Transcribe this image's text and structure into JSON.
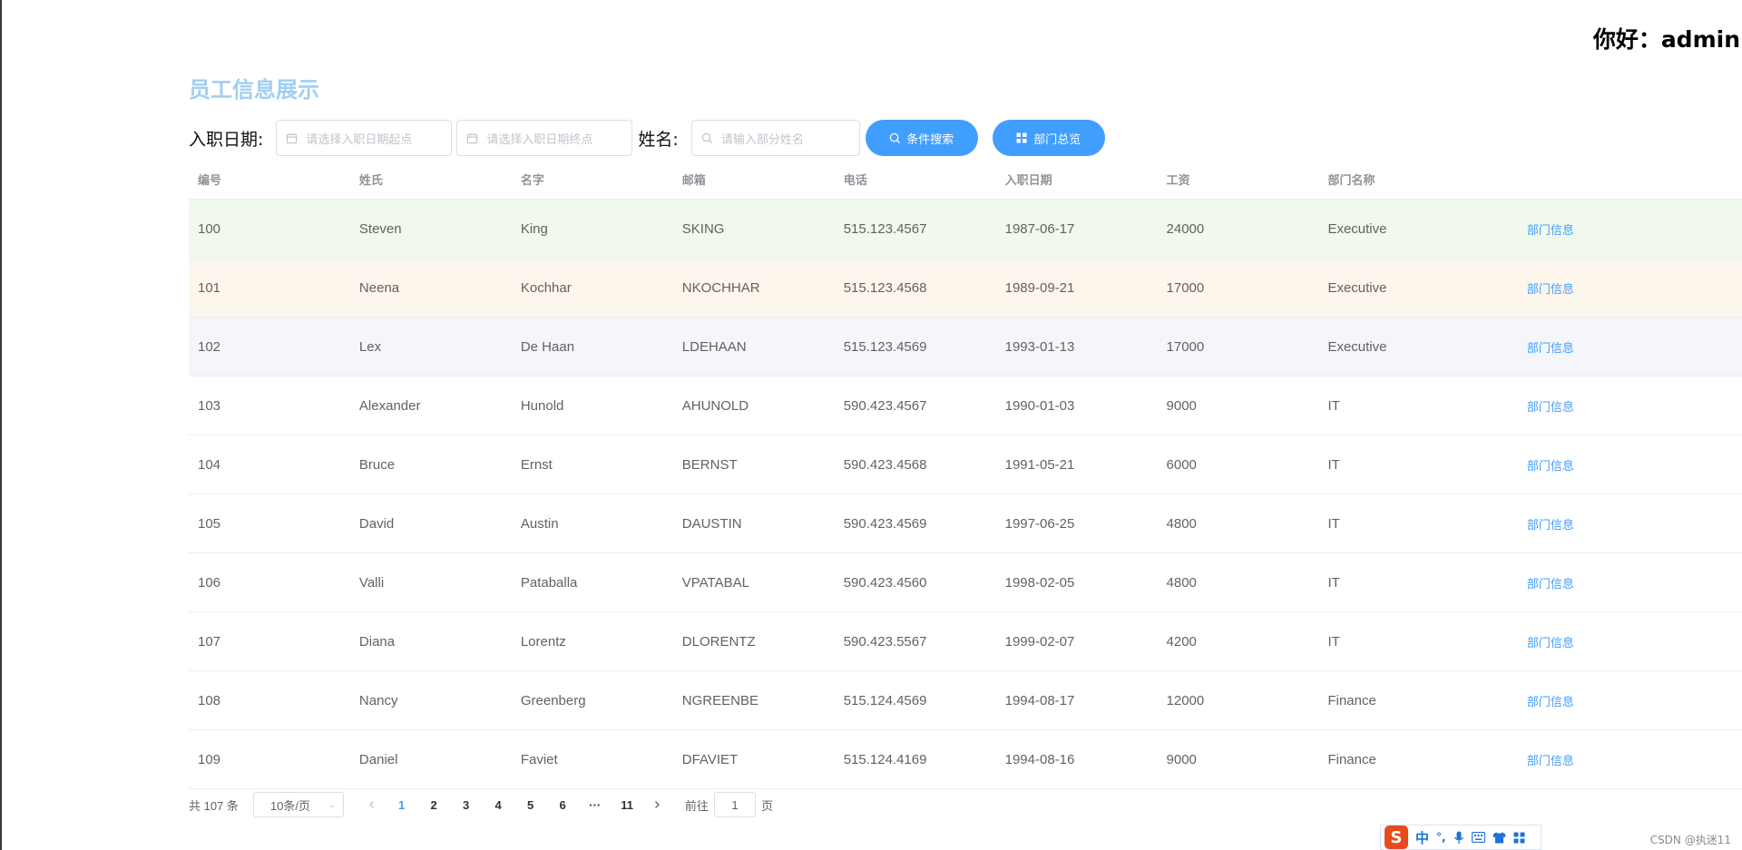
{
  "header": {
    "greeting": "你好：admin"
  },
  "page": {
    "title": "员工信息展示"
  },
  "filters": {
    "hire_date_label": "入职日期:",
    "start_placeholder": "请选择入职日期起点",
    "end_placeholder": "请选择入职日期终点",
    "name_label": "姓名:",
    "name_placeholder": "请输入部分姓名",
    "search_button": "条件搜索",
    "dept_overview_button": "部门总览"
  },
  "table": {
    "columns": [
      "编号",
      "姓氏",
      "名字",
      "邮箱",
      "电话",
      "入职日期",
      "工资",
      "部门名称"
    ],
    "action_label": "部门信息",
    "rows": [
      [
        "100",
        "Steven",
        "King",
        "SKING",
        "515.123.4567",
        "1987-06-17",
        "24000",
        "Executive"
      ],
      [
        "101",
        "Neena",
        "Kochhar",
        "NKOCHHAR",
        "515.123.4568",
        "1989-09-21",
        "17000",
        "Executive"
      ],
      [
        "102",
        "Lex",
        "De Haan",
        "LDEHAAN",
        "515.123.4569",
        "1993-01-13",
        "17000",
        "Executive"
      ],
      [
        "103",
        "Alexander",
        "Hunold",
        "AHUNOLD",
        "590.423.4567",
        "1990-01-03",
        "9000",
        "IT"
      ],
      [
        "104",
        "Bruce",
        "Ernst",
        "BERNST",
        "590.423.4568",
        "1991-05-21",
        "6000",
        "IT"
      ],
      [
        "105",
        "David",
        "Austin",
        "DAUSTIN",
        "590.423.4569",
        "1997-06-25",
        "4800",
        "IT"
      ],
      [
        "106",
        "Valli",
        "Pataballa",
        "VPATABAL",
        "590.423.4560",
        "1998-02-05",
        "4800",
        "IT"
      ],
      [
        "107",
        "Diana",
        "Lorentz",
        "DLORENTZ",
        "590.423.5567",
        "1999-02-07",
        "4200",
        "IT"
      ],
      [
        "108",
        "Nancy",
        "Greenberg",
        "NGREENBE",
        "515.124.4569",
        "1994-08-17",
        "12000",
        "Finance"
      ],
      [
        "109",
        "Daniel",
        "Faviet",
        "DFAVIET",
        "515.124.4169",
        "1994-08-16",
        "9000",
        "Finance"
      ]
    ]
  },
  "pagination": {
    "total_text": "共 107 条",
    "page_size": "10条/页",
    "pages": [
      "1",
      "2",
      "3",
      "4",
      "5",
      "6",
      "···",
      "11"
    ],
    "current_page": "1",
    "goto_prefix": "前往",
    "goto_value": "1",
    "goto_suffix": "页"
  },
  "ime": {
    "logo": "S",
    "mode": "中",
    "punct": "°,"
  },
  "watermark": "CSDN @执迷11",
  "colors": {
    "accent": "#409eff",
    "title": "#a0cff3",
    "row_success": "#f0f9eb",
    "row_warning": "#fdf6ec",
    "row_info": "#f4f6f9"
  }
}
